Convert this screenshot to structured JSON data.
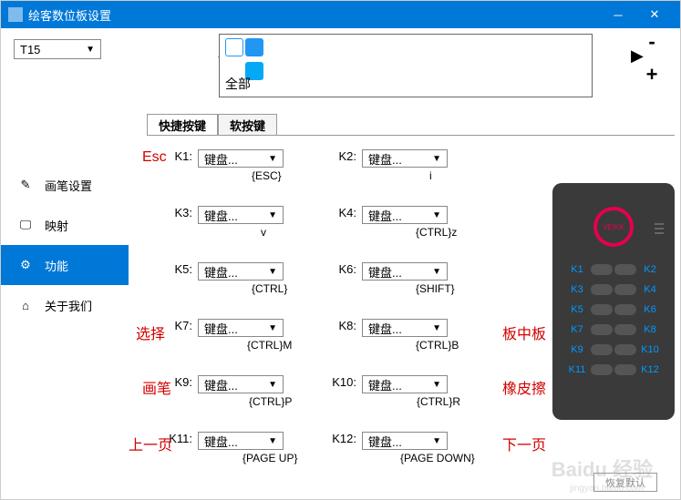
{
  "window": {
    "title": "绘客数位板设置"
  },
  "device_select": {
    "value": "T15"
  },
  "appbar": {
    "label": "全部"
  },
  "nav": {
    "items": [
      {
        "label": "画笔设置"
      },
      {
        "label": "映射"
      },
      {
        "label": "功能"
      },
      {
        "label": "关于我们"
      }
    ]
  },
  "tabs": {
    "shortcut": "快捷按键",
    "soft": "软按键"
  },
  "drop_label": "键盘...",
  "keys": [
    {
      "k": "K1:",
      "v": "{ESC}"
    },
    {
      "k": "K2:",
      "v": "i"
    },
    {
      "k": "K3:",
      "v": "v"
    },
    {
      "k": "K4:",
      "v": "{CTRL}z"
    },
    {
      "k": "K5:",
      "v": "{CTRL}"
    },
    {
      "k": "K6:",
      "v": "{SHIFT}"
    },
    {
      "k": "K7:",
      "v": "{CTRL}M"
    },
    {
      "k": "K8:",
      "v": "{CTRL}B"
    },
    {
      "k": "K9:",
      "v": "{CTRL}P"
    },
    {
      "k": "K10:",
      "v": "{CTRL}R"
    },
    {
      "k": "K11:",
      "v": "{PAGE UP}"
    },
    {
      "k": "K12:",
      "v": "{PAGE DOWN}"
    }
  ],
  "anno": {
    "esc": "Esc",
    "sel": "选择",
    "board": "板中板",
    "pen": "画笔",
    "eraser": "橡皮擦",
    "prev": "上一页",
    "next": "下一页"
  },
  "dkeys": [
    "K1",
    "K2",
    "K3",
    "K4",
    "K5",
    "K6",
    "K7",
    "K8",
    "K9",
    "K10",
    "K11",
    "K12"
  ],
  "dev_brand": "VEIKK",
  "reset": "恢复默认",
  "watermark": "Baidu 经验",
  "watermark_url": "jingyan.baidu.com"
}
